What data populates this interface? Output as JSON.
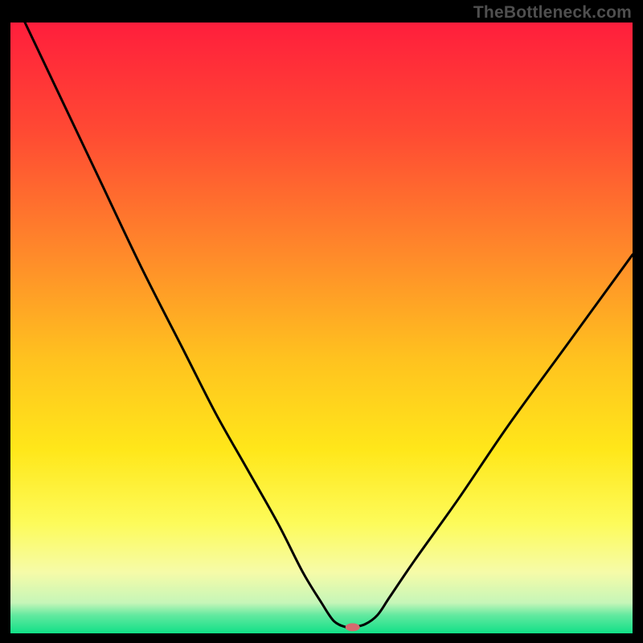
{
  "watermark": "TheBottleneck.com",
  "chart_data": {
    "type": "line",
    "title": "",
    "xlabel": "",
    "ylabel": "",
    "xlim": [
      0,
      100
    ],
    "ylim": [
      0,
      100
    ],
    "gradient_stops": [
      {
        "offset": 0,
        "color": "#ff1e3c"
      },
      {
        "offset": 18,
        "color": "#ff4a33"
      },
      {
        "offset": 38,
        "color": "#ff8a2a"
      },
      {
        "offset": 55,
        "color": "#ffc21f"
      },
      {
        "offset": 70,
        "color": "#ffe71a"
      },
      {
        "offset": 82,
        "color": "#fdfb5a"
      },
      {
        "offset": 90,
        "color": "#f6fba8"
      },
      {
        "offset": 95,
        "color": "#c6f6b8"
      },
      {
        "offset": 97,
        "color": "#63e9a0"
      },
      {
        "offset": 100,
        "color": "#11e087"
      }
    ],
    "series": [
      {
        "name": "bottleneck-curve",
        "x": [
          0,
          7,
          14,
          21,
          28,
          33,
          38,
          43,
          47,
          50,
          52,
          54,
          55,
          57,
          59,
          61,
          65,
          72,
          80,
          90,
          100
        ],
        "y": [
          105,
          90,
          75,
          60,
          46,
          36,
          27,
          18,
          10,
          5,
          2,
          1,
          1,
          1.5,
          3,
          6,
          12,
          22,
          34,
          48,
          62
        ]
      }
    ],
    "marker": {
      "x": 55,
      "y": 1,
      "color": "#d46a6f",
      "rx": 9,
      "ry": 5
    }
  }
}
